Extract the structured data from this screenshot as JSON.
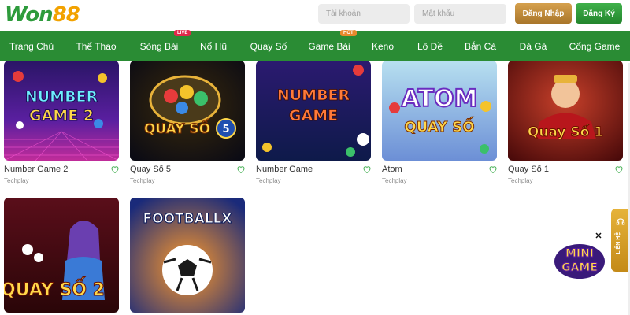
{
  "header": {
    "logo_left": "Won",
    "logo_right": "88",
    "username_placeholder": "Tài khoản",
    "password_placeholder": "Mật khẩu",
    "login_label": "Đăng Nhập",
    "register_label": "Đăng Ký"
  },
  "nav": {
    "items": [
      {
        "label": "Trang Chủ"
      },
      {
        "label": "Thể Thao"
      },
      {
        "label": "Sòng Bài",
        "badge": "LIVE"
      },
      {
        "label": "Nổ Hũ"
      },
      {
        "label": "Quay Số"
      },
      {
        "label": "Game Bài",
        "badge": "HOT"
      },
      {
        "label": "Keno"
      },
      {
        "label": "Lô Đề"
      },
      {
        "label": "Bắn Cá"
      },
      {
        "label": "Đá Gà"
      },
      {
        "label": "Cổng Game"
      }
    ]
  },
  "games": [
    {
      "name": "Number Game 2",
      "provider": "Techplay",
      "art": "NUMBER GAME 2"
    },
    {
      "name": "Quay Số 5",
      "provider": "Techplay",
      "art": "QUAY SỐ 5"
    },
    {
      "name": "Number Game",
      "provider": "Techplay",
      "art": "NUMBER GAME"
    },
    {
      "name": "Atom",
      "provider": "Techplay",
      "art": "ATOM QUAY SỐ"
    },
    {
      "name": "Quay Số 1",
      "provider": "Techplay",
      "art": "Quay Số 1"
    },
    {
      "name": "",
      "provider": "",
      "art": "QUAY SỐ 2"
    },
    {
      "name": "",
      "provider": "",
      "art": "FOOTBALLX"
    }
  ],
  "widgets": {
    "contact_label": "LIÊN HỆ",
    "mini_game_top": "MINI",
    "mini_game_bottom": "GAME",
    "close_glyph": "✕"
  },
  "colors": {
    "brand_green": "#2a8c34",
    "login_gold": "#c08a33",
    "register_green": "#2e9b3c",
    "live_badge": "#e0284a",
    "hot_badge": "#e8892c"
  }
}
